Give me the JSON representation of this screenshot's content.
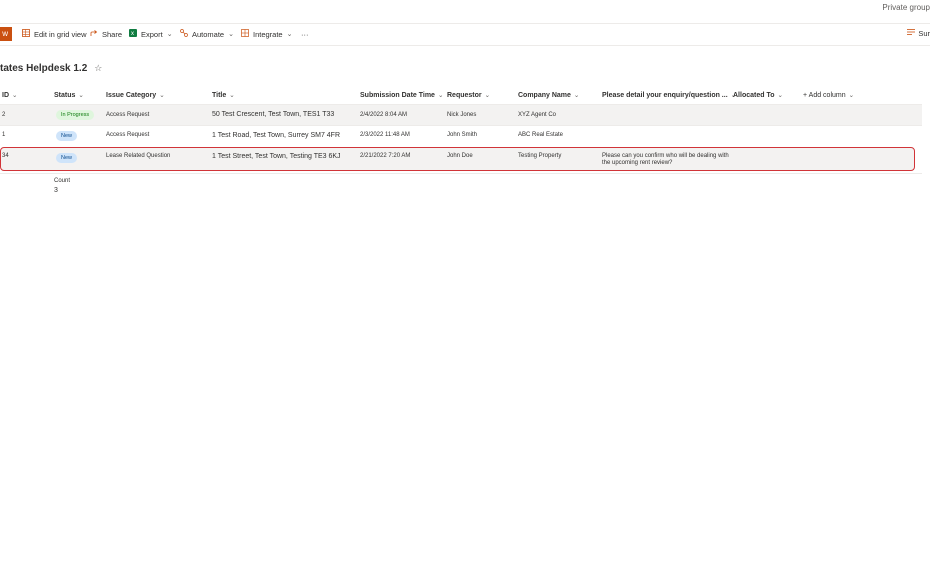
{
  "header": {
    "privacy": "Private group"
  },
  "toolbar": {
    "new_label": "w",
    "edit_grid": "Edit in grid view",
    "share": "Share",
    "export": "Export",
    "automate": "Automate",
    "integrate": "Integrate",
    "more": "···",
    "summary": "Sur"
  },
  "list": {
    "title": "tates Helpdesk 1.2"
  },
  "columns": {
    "id": "ID",
    "status": "Status",
    "issue_category": "Issue Category",
    "title": "Title",
    "submission": "Submission Date Time",
    "requestor": "Requestor",
    "company": "Company Name",
    "enquiry": "Please detail your enquiry/question ...",
    "allocated": "Allocated To",
    "add_column": "+ Add column"
  },
  "rows": [
    {
      "id": "2",
      "status": "In Progress",
      "issue_category": "Access Request",
      "title": "50 Test Crescent, Test Town, TES1 T33",
      "submission": "2/4/2022 8:04 AM",
      "requestor": "Nick Jones",
      "company": "XYZ Agent Co",
      "enquiry": ""
    },
    {
      "id": "1",
      "status": "New",
      "issue_category": "Access Request",
      "title": "1 Test Road, Test Town, Surrey SM7 4FR",
      "submission": "2/3/2022 11:48 AM",
      "requestor": "John Smith",
      "company": "ABC Real Estate",
      "enquiry": ""
    },
    {
      "id": "34",
      "status": "New",
      "issue_category": "Lease Related Question",
      "title": "1 Test Street, Test Town, Testing TE3 6KJ",
      "submission": "2/21/2022 7:20 AM",
      "requestor": "John Doe",
      "company": "Testing Property",
      "enquiry": "Please can you confirm who will be dealing with the upcoming rent review?"
    }
  ],
  "footer": {
    "count_label": "Count",
    "count_value": "3"
  },
  "colors": {
    "accent": "#ca5010",
    "selected_border": "#d13438",
    "progress_bg": "#dff6dd",
    "new_bg": "#cfe4fa"
  }
}
